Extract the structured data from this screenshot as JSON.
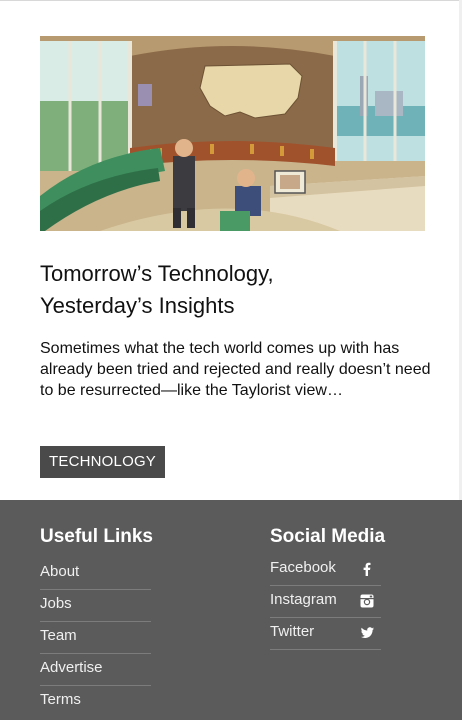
{
  "article": {
    "title_line1": "Tomorrow’s Technology,",
    "title_line2": "Yesterday’s Insights",
    "excerpt": "Sometimes what the tech world comes up with has already been tried and rejected and really doesn’t need to be resurrected—like the Taylorist view…",
    "tag": "TECHNOLOGY"
  },
  "footer": {
    "useful_links": {
      "heading": "Useful Links",
      "items": [
        {
          "label": "About"
        },
        {
          "label": "Jobs"
        },
        {
          "label": "Team"
        },
        {
          "label": "Advertise"
        },
        {
          "label": "Terms"
        }
      ]
    },
    "social_media": {
      "heading": "Social Media",
      "items": [
        {
          "label": "Facebook",
          "icon": "facebook-icon"
        },
        {
          "label": "Instagram",
          "icon": "instagram-icon"
        },
        {
          "label": "Twitter",
          "icon": "twitter-icon"
        }
      ]
    }
  }
}
